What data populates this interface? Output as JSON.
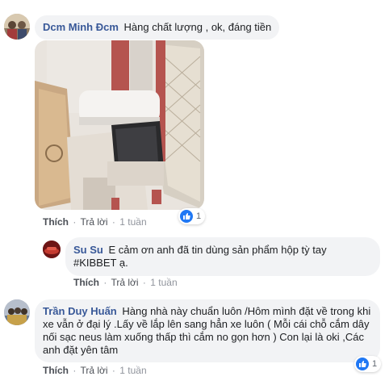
{
  "comments": [
    {
      "author": "Dcm Minh Đcm",
      "text": "Hàng chất lượng , ok, đáng tiền",
      "actions": {
        "like": "Thích",
        "reply": "Trả lời",
        "time": "1 tuần"
      },
      "reaction_count": "1",
      "photo_icon": "car-armrest-photo"
    },
    {
      "author": "Su Su",
      "text": "E cảm ơn anh đã tin dùng sản phẩm hộp tỳ tay #KIBBET ạ.",
      "actions": {
        "like": "Thích",
        "reply": "Trả lời",
        "time": "1 tuần"
      }
    },
    {
      "author": "Trần Duy Huấn",
      "text": "Hàng nhà này chuẩn luôn /Hôm mình đặt về trong khi xe vẫn ở đại lý .Lấy về lắp lên sang hẳn xe luôn ( Mỗi cái chỗ cắm dây nối sạc neus làm xuống thấp thì cắm no gọn hơn ) Con lại là oki ,Các anh đặt yên tâm",
      "actions": {
        "like": "Thích",
        "reply": "Trả lời",
        "time": "1 tuần"
      },
      "reaction_count": "1"
    }
  ],
  "colors": {
    "author": "#385898",
    "bubble": "#f2f3f5",
    "like_blue": "#2078f4"
  },
  "icons": [
    "avatar-dcm",
    "avatar-susu",
    "avatar-tran",
    "like-icon"
  ]
}
